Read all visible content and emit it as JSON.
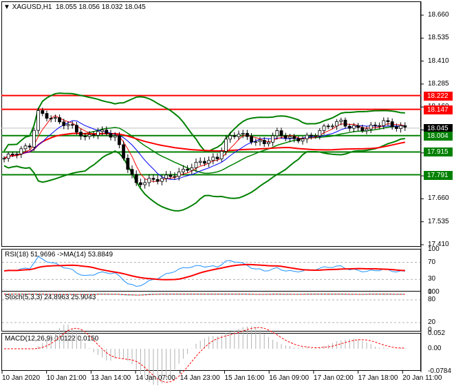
{
  "header": {
    "symbol": "XAGUSD,H1",
    "ohlc": "18.055 18.056 18.032 18.045"
  },
  "price_axis": [
    "18.660",
    "18.535",
    "18.410",
    "18.285",
    "18.160",
    "18.035",
    "17.910",
    "17.785",
    "17.660",
    "17.535",
    "17.410"
  ],
  "levels": [
    {
      "value": "18.222",
      "color": "#ff0000"
    },
    {
      "value": "18.147",
      "color": "#ff0000"
    },
    {
      "value": "18.045",
      "color": "#000000"
    },
    {
      "value": "18.004",
      "color": "#008000"
    },
    {
      "value": "17.915",
      "color": "#008000"
    },
    {
      "value": "17.791",
      "color": "#008000"
    }
  ],
  "price_path": [
    [
      0,
      17.88
    ],
    [
      6,
      17.95
    ],
    [
      8,
      18.13
    ],
    [
      12,
      18.09
    ],
    [
      16,
      18.05
    ],
    [
      19,
      17.99
    ],
    [
      22,
      18.03
    ],
    [
      26,
      18.0
    ],
    [
      29,
      17.83
    ],
    [
      31,
      17.74
    ],
    [
      34,
      17.76
    ],
    [
      37,
      17.77
    ],
    [
      41,
      17.8
    ],
    [
      46,
      17.86
    ],
    [
      50,
      17.88
    ],
    [
      52,
      17.98
    ],
    [
      55,
      18.02
    ],
    [
      58,
      17.98
    ],
    [
      61,
      17.96
    ],
    [
      64,
      18.02
    ],
    [
      68,
      17.98
    ],
    [
      72,
      18.0
    ],
    [
      76,
      18.06
    ],
    [
      79,
      18.08
    ],
    [
      81,
      18.05
    ],
    [
      85,
      18.04
    ],
    [
      89,
      18.08
    ],
    [
      92,
      18.05
    ],
    [
      94,
      18.045
    ]
  ],
  "rsi": {
    "label": "RSI(18) 51.9696  ->MA(14) 53.8849",
    "axis": [
      "100",
      "70",
      "30",
      "0"
    ]
  },
  "stoch": {
    "label": "Stoch(5,3,3) 24.8963 25.9043",
    "axis": [
      "100",
      "80",
      "20",
      "0"
    ]
  },
  "macd": {
    "label": "MACD(12,26,9) 0.0122 0.0150",
    "axis": [
      "0.052",
      "0.00",
      "-0.0784"
    ]
  },
  "time_axis": [
    "10 Jan 2020",
    "10 Jan 21:00",
    "13 Jan 14:00",
    "14 Jan 07:00",
    "14 Jan 23:00",
    "15 Jan 16:00",
    "16 Jan 09:00",
    "17 Jan 02:00",
    "17 Jan 18:00",
    "20 Jan 11:00"
  ],
  "colors": {
    "bull": "#000000",
    "bear": "#000000",
    "bands": "#008000",
    "ma_fast": "#0000ff",
    "ma_slow": "#ff0000",
    "rsi": "#1e90ff",
    "stoch": "#20b2aa"
  }
}
